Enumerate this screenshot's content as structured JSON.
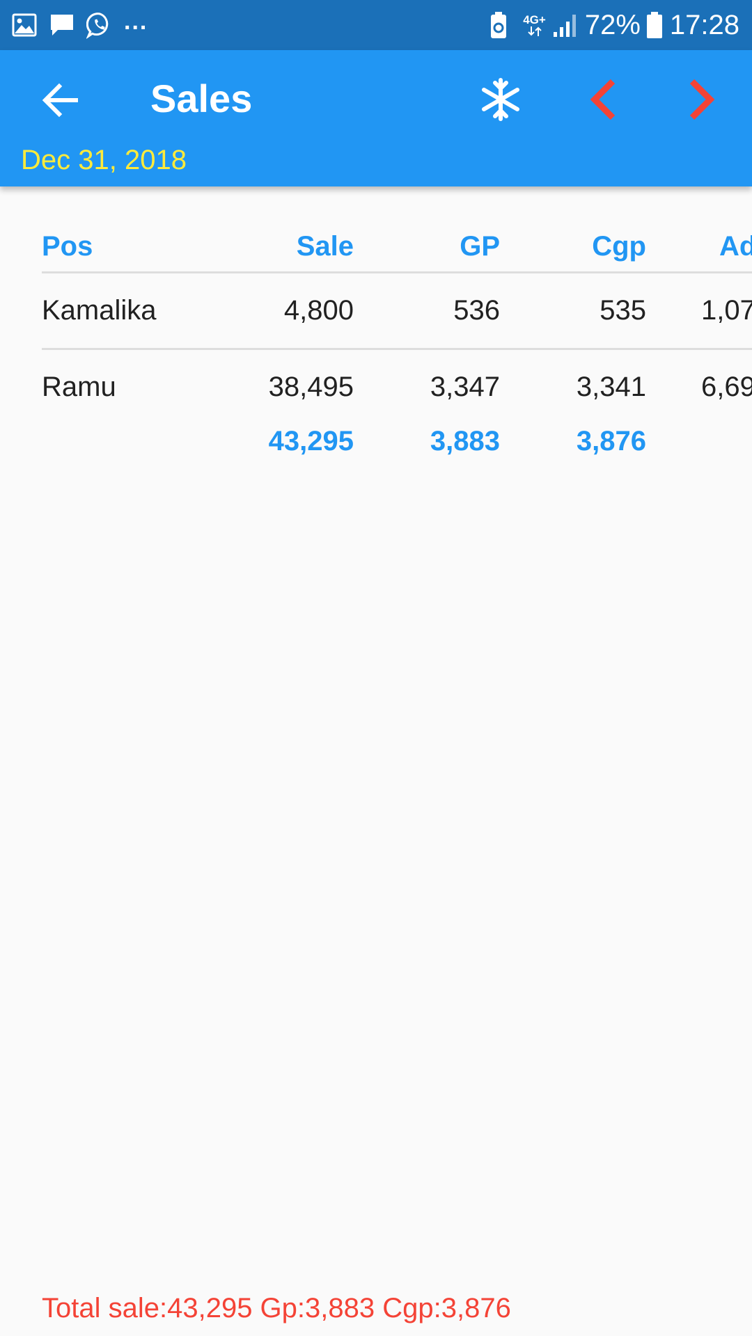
{
  "status_bar": {
    "left_icons": [
      "image-icon",
      "message-icon",
      "whatsapp-icon"
    ],
    "overflow_dots": "...",
    "network_label": "4G+",
    "battery_percent": "72%",
    "time": "17:28"
  },
  "app_bar": {
    "title": "Sales",
    "date": "Dec 31, 2018",
    "icons": {
      "back": "arrow-left-icon",
      "freeze": "snowflake-icon",
      "prev": "chevron-left-icon",
      "next": "chevron-right-icon"
    },
    "colors": {
      "background": "#2196f3",
      "date": "#ffeb3b",
      "nav_arrows": "#f44336"
    }
  },
  "table": {
    "headers": [
      "Pos",
      "Sale",
      "GP",
      "Cgp",
      "Ad"
    ],
    "rows": [
      [
        "Kamalika",
        "4,800",
        "536",
        "535",
        "1,07"
      ],
      [
        "Ramu",
        "38,495",
        "3,347",
        "3,341",
        "6,69"
      ]
    ],
    "totals": [
      "",
      "43,295",
      "3,883",
      "3,876",
      ""
    ]
  },
  "footer": {
    "summary": "Total sale:43,295 Gp:3,883 Cgp:3,876",
    "color": "#f44336"
  }
}
